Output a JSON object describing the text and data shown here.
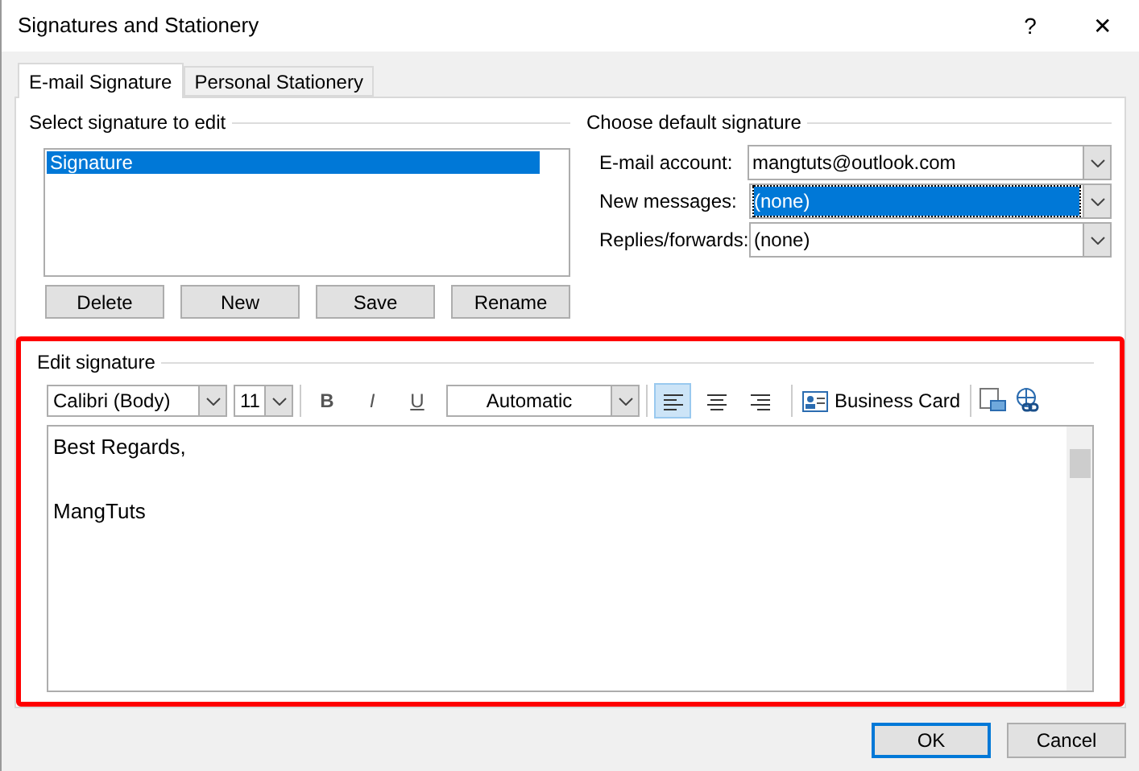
{
  "window": {
    "title": "Signatures and Stationery",
    "buttons": [
      "?",
      "✕"
    ]
  },
  "tabs": [
    {
      "label": "E-mail Signature",
      "selected": true
    },
    {
      "label": "Personal Stationery",
      "selected": false
    }
  ],
  "select_signature": {
    "label": "Select signature to edit",
    "items": [
      {
        "label": "Signature",
        "selected": true
      }
    ],
    "buttons": [
      "Delete",
      "New",
      "Save",
      "Rename"
    ]
  },
  "default_signature": {
    "label": "Choose default signature",
    "fields": [
      {
        "label": "E-mail account:",
        "value": "mangtuts@outlook.com",
        "selected": false
      },
      {
        "label": "New messages:",
        "value": "(none)",
        "selected": true
      },
      {
        "label": "Replies/forwards:",
        "value": "(none)",
        "selected": false
      }
    ]
  },
  "edit_signature": {
    "label": "Edit signature",
    "highlighted": true,
    "toolbar": {
      "font": "Calibri (Body)",
      "size": "11",
      "bold": "B",
      "italic": "I",
      "underline": "U",
      "color_label": "Automatic",
      "align": [
        {
          "kind": "left",
          "selected": true
        },
        {
          "kind": "center",
          "selected": false
        },
        {
          "kind": "right",
          "selected": false
        }
      ],
      "business_card": "Business Card"
    },
    "paragraphs": [
      "Best Regards,",
      "MangTuts"
    ]
  },
  "buttons": [
    {
      "label": "OK",
      "default": true
    },
    {
      "label": "Cancel",
      "default": false
    }
  ]
}
